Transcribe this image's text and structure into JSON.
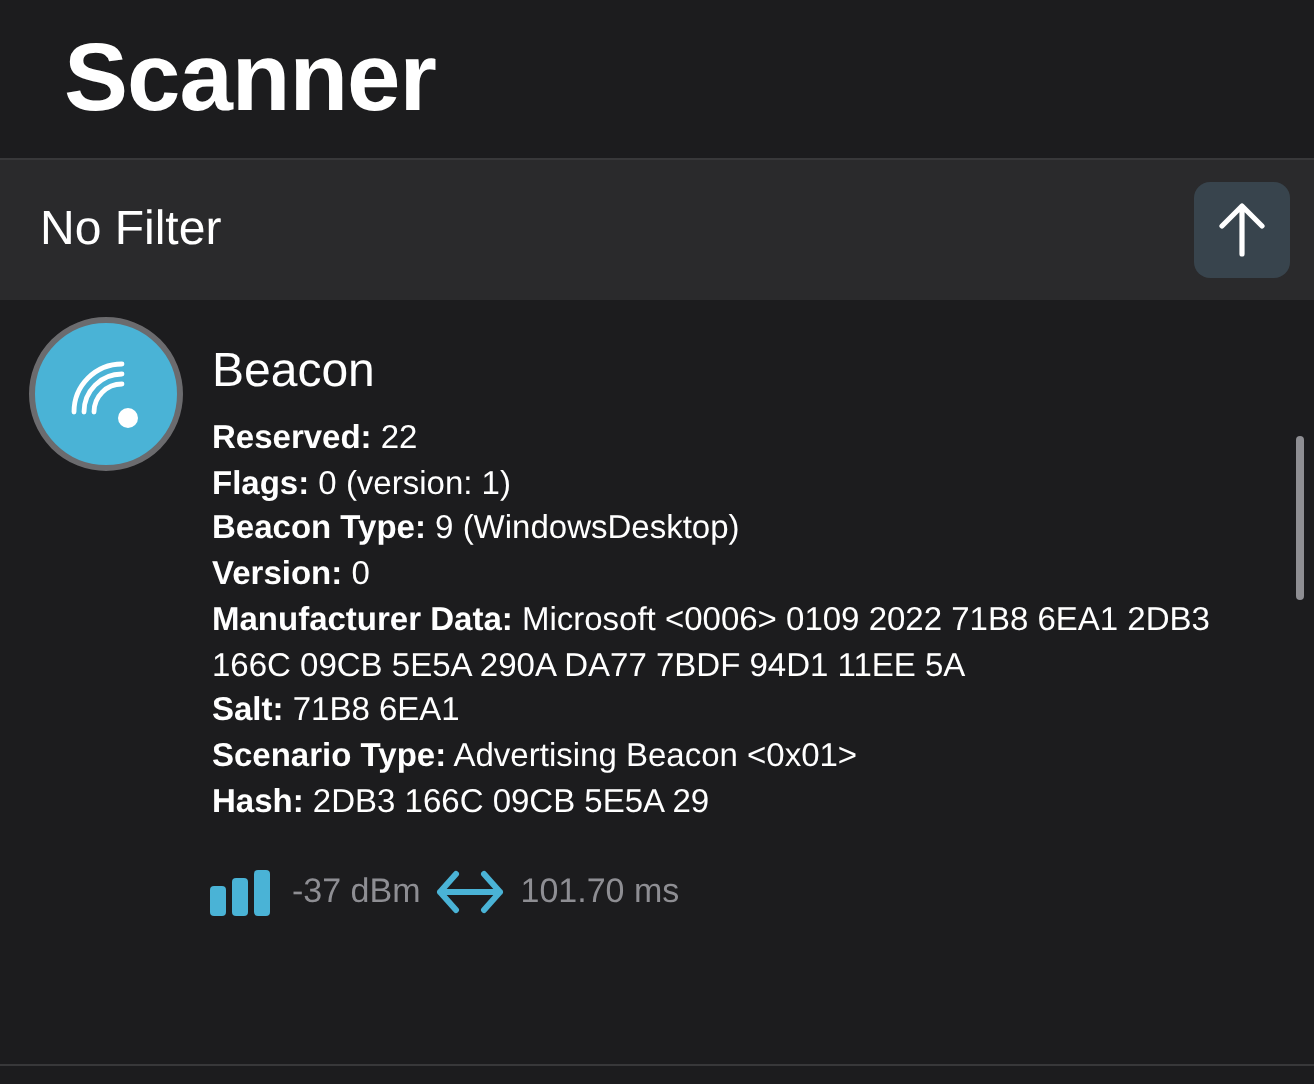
{
  "title": "Scanner",
  "filter": {
    "label": "No Filter"
  },
  "device": {
    "name": "Beacon",
    "fields": [
      "**Reserved:** 22",
      "**Flags:** 0 (version: 1)",
      "**Beacon Type:** 9 (WindowsDesktop)",
      "**Version:** 0",
      "**Manufacturer Data:** Microsoft <0006> 0109 2022 71B8 6EA1 2DB3 166C 09CB 5E5A 290A DA77 7BDF 94D1 11EE 5A",
      "**Salt:** 71B8 6EA1",
      "**Scenario Type:** Advertising Beacon <0x01>",
      "**Hash:** 2DB3 166C 09CB 5E5A 29"
    ],
    "rssi": "-37 dBm",
    "interval": "101.70 ms"
  }
}
